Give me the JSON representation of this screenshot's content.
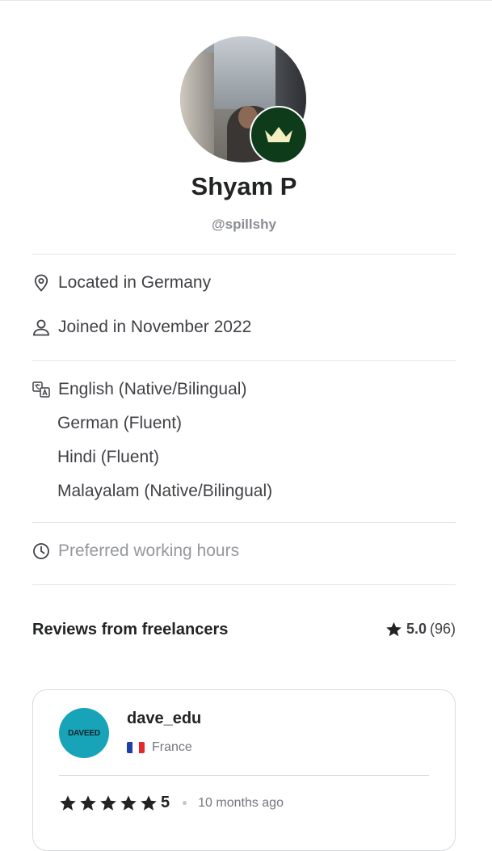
{
  "profile": {
    "name": "Shyam P",
    "handle": "@spillshy"
  },
  "info": {
    "location": "Located in Germany",
    "joined": "Joined in November 2022"
  },
  "languages": [
    "English (Native/Bilingual)",
    "German (Fluent)",
    "Hindi (Fluent)",
    "Malayalam (Native/Bilingual)"
  ],
  "working_hours": "Preferred working hours",
  "reviews": {
    "title": "Reviews from freelancers",
    "rating": "5.0",
    "count": "(96)",
    "items": [
      {
        "avatar_text": "DAVEED",
        "name": "dave_edu",
        "country": "France",
        "score": "5",
        "stars": 5,
        "ago": "10 months ago"
      }
    ]
  },
  "colors": {
    "crown_badge": "#0e3b1a",
    "crown": "#f4efc2",
    "reviewer_avatar": "#17a4b9",
    "star": "#222325"
  }
}
